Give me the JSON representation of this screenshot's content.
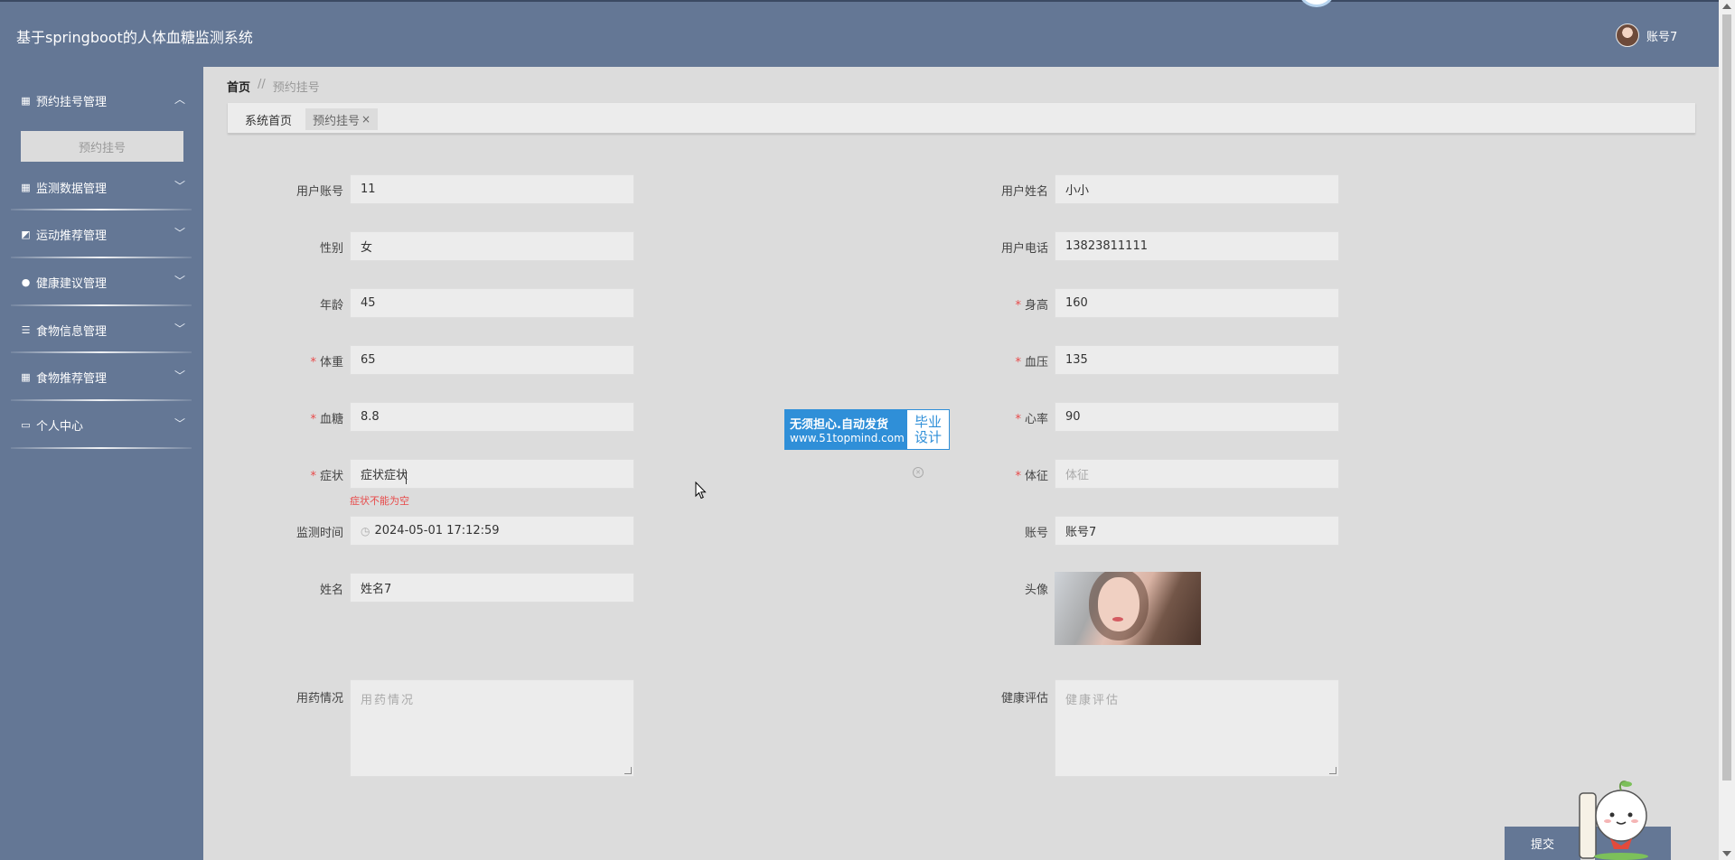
{
  "header": {
    "title": "基于springboot的人体血糖监测系统",
    "username": "账号7"
  },
  "sidebar": {
    "menus": [
      {
        "label": "预约挂号管理",
        "icon": "grid-icon",
        "expanded": true
      },
      {
        "label": "监测数据管理",
        "icon": "grid-icon",
        "expanded": false
      },
      {
        "label": "运动推荐管理",
        "icon": "chart-icon",
        "expanded": false
      },
      {
        "label": "健康建议管理",
        "icon": "bulb-icon",
        "expanded": false
      },
      {
        "label": "食物信息管理",
        "icon": "list-icon",
        "expanded": false
      },
      {
        "label": "食物推荐管理",
        "icon": "grid-icon",
        "expanded": false
      },
      {
        "label": "个人中心",
        "icon": "card-icon",
        "expanded": false
      }
    ],
    "submenu_active": "预约挂号"
  },
  "breadcrumb": {
    "home": "首页",
    "separator": "//",
    "current": "预约挂号"
  },
  "tabs": [
    {
      "label": "系统首页",
      "active": false
    },
    {
      "label": "预约挂号",
      "active": true,
      "close": "×"
    }
  ],
  "form": {
    "user_account": {
      "label": "用户账号",
      "value": "11"
    },
    "user_name": {
      "label": "用户姓名",
      "value": "小小"
    },
    "gender": {
      "label": "性别",
      "value": "女"
    },
    "user_phone": {
      "label": "用户电话",
      "value": "13823811111"
    },
    "age": {
      "label": "年龄",
      "value": "45"
    },
    "height": {
      "label": "身高",
      "value": "160",
      "required": "*"
    },
    "weight": {
      "label": "体重",
      "value": "65",
      "required": "*"
    },
    "blood_pressure": {
      "label": "血压",
      "value": "135",
      "required": "*"
    },
    "blood_sugar": {
      "label": "血糖",
      "value": "8.8",
      "required": "*"
    },
    "heart_rate": {
      "label": "心率",
      "value": "90",
      "required": "*"
    },
    "symptom": {
      "label": "症状",
      "value": "症状症状",
      "required": "*",
      "error": "症状不能为空"
    },
    "sign": {
      "label": "体征",
      "placeholder": "体征",
      "required": "*"
    },
    "monitor_time": {
      "label": "监测时间",
      "value": "2024-05-01 17:12:59"
    },
    "account": {
      "label": "账号",
      "value": "账号7"
    },
    "name": {
      "label": "姓名",
      "value": "姓名7"
    },
    "avatar": {
      "label": "头像"
    },
    "medication": {
      "label": "用药情况",
      "placeholder": "用药情况"
    },
    "health_eval": {
      "label": "健康评估",
      "placeholder": "健康评估"
    }
  },
  "watermark": {
    "line1": "无须担心.自动发货",
    "line2": "www.51topmind.com",
    "right1": "毕业",
    "right2": "设计"
  },
  "actions": {
    "submit": "提交"
  },
  "colors": {
    "primary": "#647795",
    "background": "#dcdcdc",
    "required": "#e84a4a",
    "watermark": "#2f8fd8"
  }
}
